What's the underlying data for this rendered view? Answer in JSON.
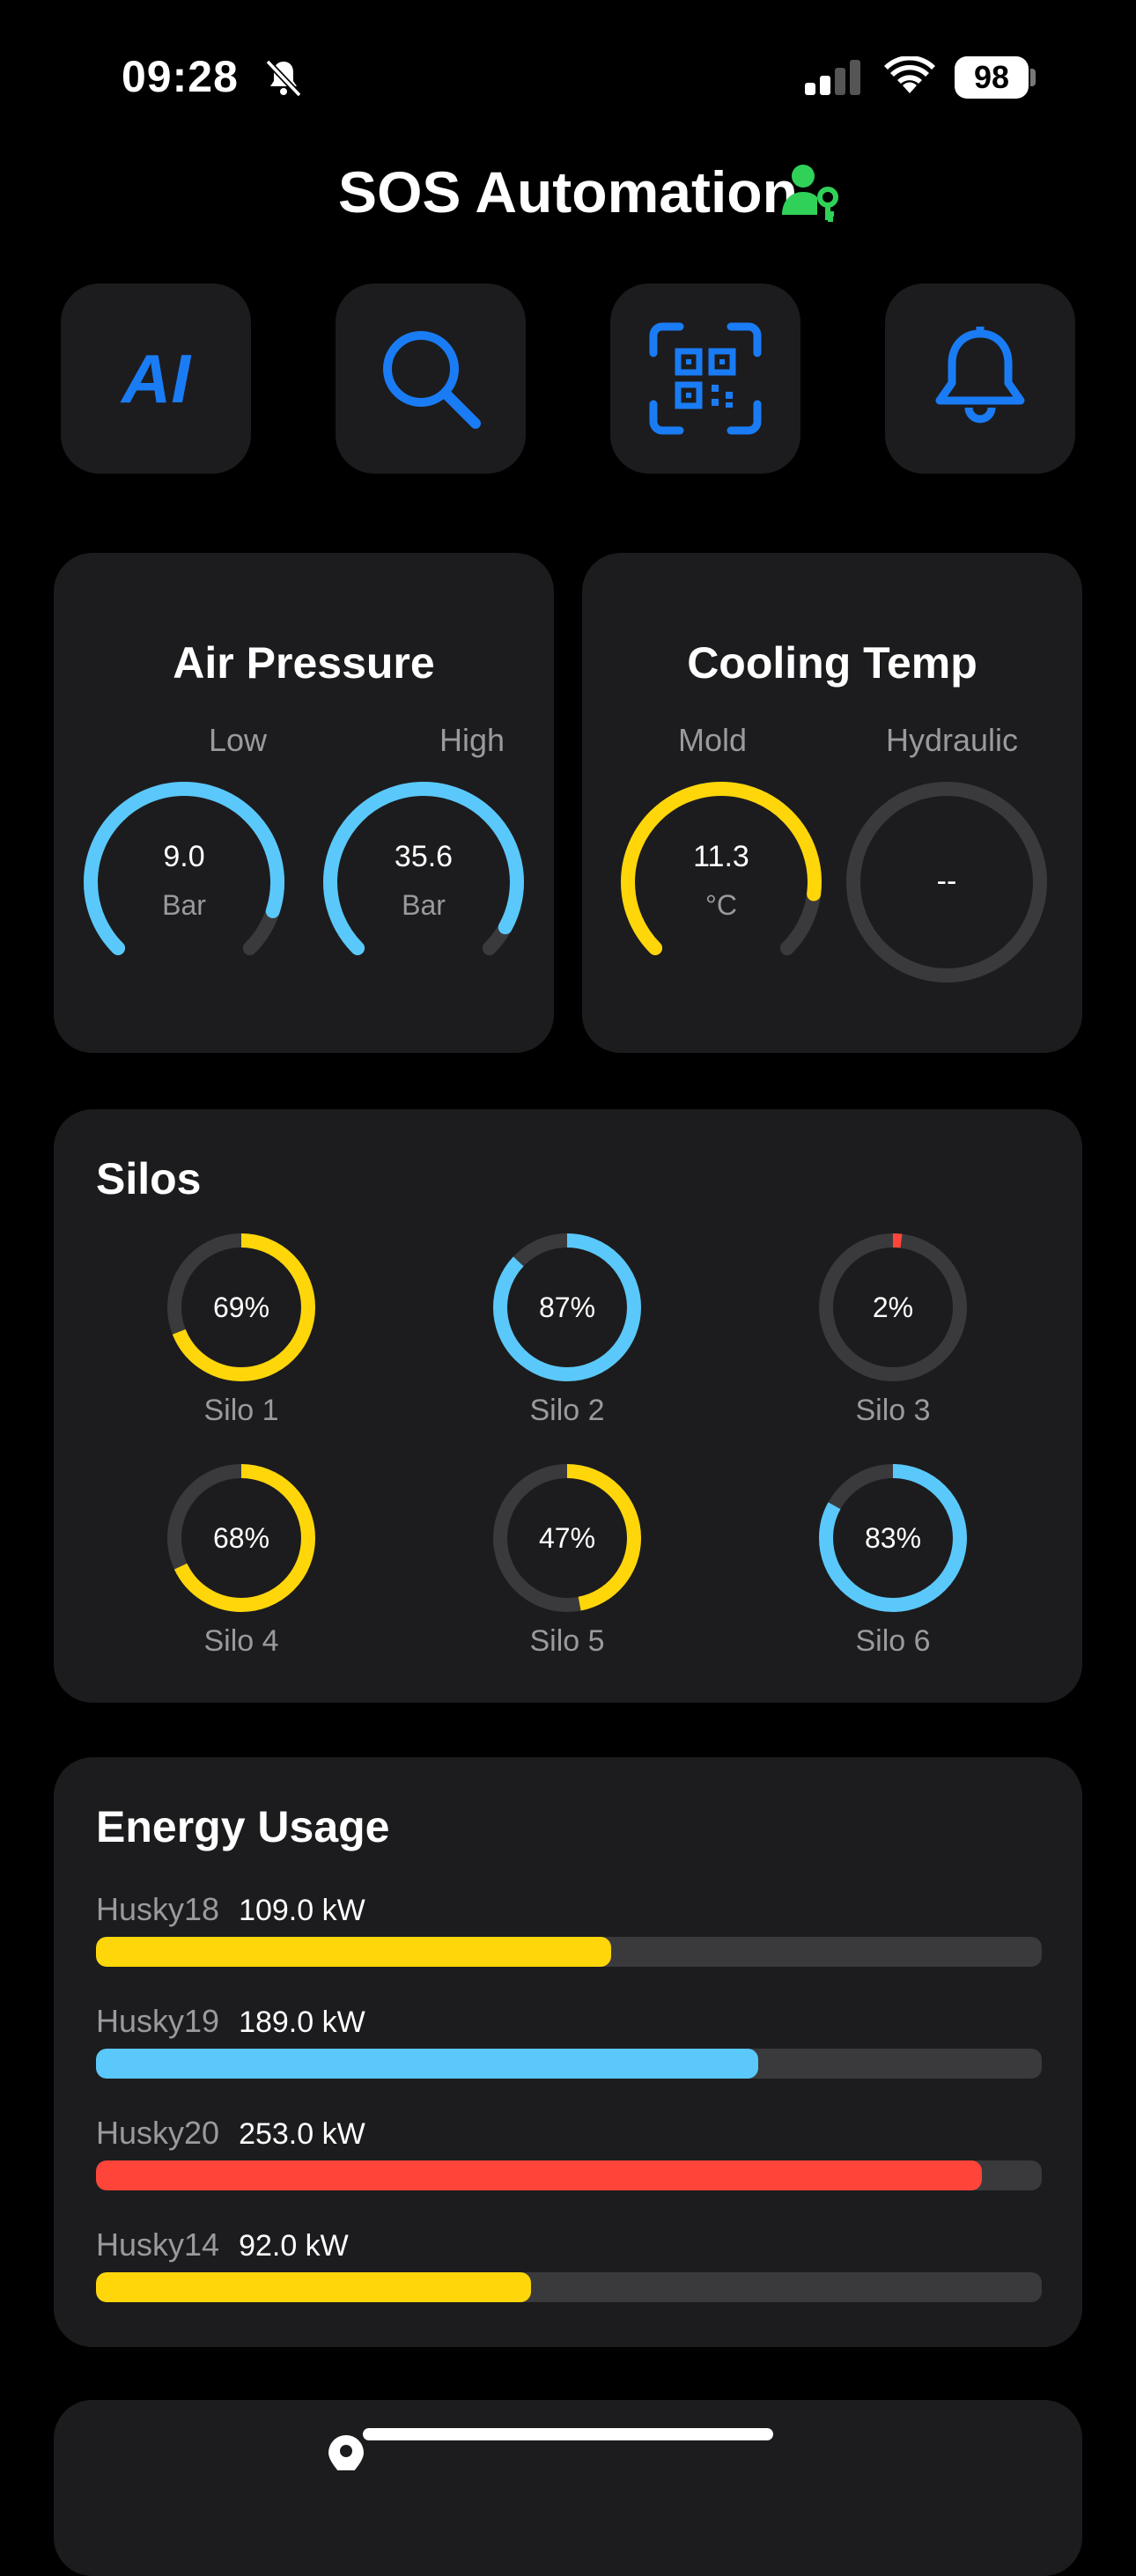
{
  "status": {
    "time": "09:28",
    "battery": "98"
  },
  "header": {
    "title": "SOS Automation",
    "user_icon": "person-key-icon"
  },
  "quick_actions": [
    {
      "label": "AI",
      "icon": "ai-icon"
    },
    {
      "icon": "search-icon"
    },
    {
      "icon": "qr-scan-icon"
    },
    {
      "icon": "bell-icon"
    }
  ],
  "air_pressure": {
    "title": "Air Pressure",
    "gauges": [
      {
        "label": "Low",
        "value": "9.0",
        "unit": "Bar",
        "fraction": 0.9
      },
      {
        "label": "High",
        "value": "35.6",
        "unit": "Bar",
        "fraction": 0.94
      }
    ]
  },
  "cooling_temp": {
    "title": "Cooling Temp",
    "gauges": [
      {
        "label": "Mold",
        "value": "11.3",
        "unit": "°C",
        "fraction": 0.86
      },
      {
        "label": "Hydraulic",
        "value": "--",
        "unit": "",
        "fraction": 0
      }
    ]
  },
  "silos": {
    "title": "Silos",
    "items": [
      {
        "name": "Silo 1",
        "percent": "69%",
        "value": 69,
        "color": "#FFD60A"
      },
      {
        "name": "Silo 2",
        "percent": "87%",
        "value": 87,
        "color": "#5AC8FA"
      },
      {
        "name": "Silo 3",
        "percent": "2%",
        "value": 2,
        "color": "#FF453A"
      },
      {
        "name": "Silo 4",
        "percent": "68%",
        "value": 68,
        "color": "#FFD60A"
      },
      {
        "name": "Silo 5",
        "percent": "47%",
        "value": 47,
        "color": "#FFD60A"
      },
      {
        "name": "Silo 6",
        "percent": "83%",
        "value": 83,
        "color": "#5AC8FA"
      }
    ]
  },
  "energy": {
    "title": "Energy Usage",
    "items": [
      {
        "name": "Husky18",
        "value": "109.0 kW",
        "fraction": 0.545,
        "color": "#FFD60A"
      },
      {
        "name": "Husky19",
        "value": "189.0 kW",
        "fraction": 0.7,
        "color": "#5AC8FA"
      },
      {
        "name": "Husky20",
        "value": "253.0 kW",
        "fraction": 0.937,
        "color": "#FF453A"
      },
      {
        "name": "Husky14",
        "value": "92.0 kW",
        "fraction": 0.46,
        "color": "#FFD60A"
      }
    ]
  },
  "colors": {
    "accent": "#1A7CF5",
    "green": "#30D158",
    "track": "#3A3A3C",
    "card": "#1C1C1E"
  }
}
